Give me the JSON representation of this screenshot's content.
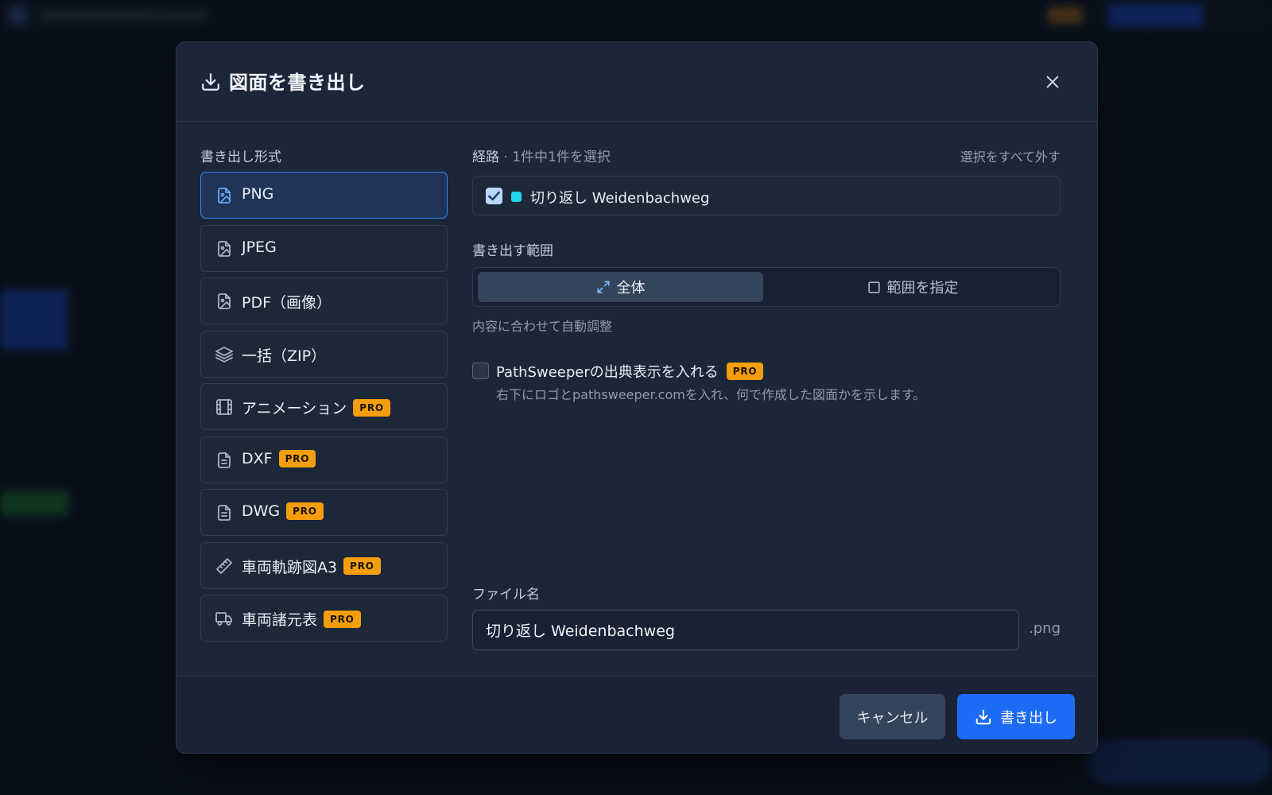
{
  "dialog": {
    "title": "図面を書き出し",
    "close_icon": "close-icon"
  },
  "format_section": {
    "label": "書き出し形式",
    "items": [
      {
        "label": "PNG",
        "icon": "image-file-icon",
        "pro": false,
        "selected": true
      },
      {
        "label": "JPEG",
        "icon": "image-file-icon",
        "pro": false,
        "selected": false
      },
      {
        "label": "PDF（画像）",
        "icon": "image-file-icon",
        "pro": false,
        "selected": false
      },
      {
        "label": "一括（ZIP）",
        "icon": "layers-icon",
        "pro": false,
        "selected": false
      },
      {
        "label": "アニメーション",
        "icon": "film-icon",
        "pro": true,
        "selected": false
      },
      {
        "label": "DXF",
        "icon": "document-icon",
        "pro": true,
        "selected": false
      },
      {
        "label": "DWG",
        "icon": "document-icon",
        "pro": true,
        "selected": false
      },
      {
        "label": "車両軌跡図A3",
        "icon": "ruler-icon",
        "pro": true,
        "selected": false
      },
      {
        "label": "車両諸元表",
        "icon": "truck-icon",
        "pro": true,
        "selected": false
      }
    ],
    "pro_badge": "PRO"
  },
  "routes": {
    "label": "経路",
    "selection_summary": " · 1件中1件を選択",
    "deselect_all": "選択をすべて外す",
    "items": [
      {
        "name": "切り返し Weidenbachweg",
        "checked": true,
        "color": "#22d3ee"
      }
    ]
  },
  "range": {
    "label": "書き出す範囲",
    "options": [
      {
        "label": "全体",
        "icon": "expand-icon",
        "active": true
      },
      {
        "label": "範囲を指定",
        "icon": "square-icon",
        "active": false
      }
    ],
    "hint": "内容に合わせて自動調整"
  },
  "attribution": {
    "checked": false,
    "label": "PathSweeperの出典表示を入れる",
    "pro_badge": "PRO",
    "description": "右下にロゴとpathsweeper.comを入れ、何で作成した図面かを示します。"
  },
  "filename": {
    "label": "ファイル名",
    "value": "切り返し Weidenbachweg",
    "extension": ".png"
  },
  "footer": {
    "cancel_label": "キャンセル",
    "export_label": "書き出し"
  },
  "colors": {
    "accent": "#1d6bf5",
    "pro": "#f59e0b",
    "route": "#22d3ee",
    "modal_bg": "#1b2639"
  }
}
